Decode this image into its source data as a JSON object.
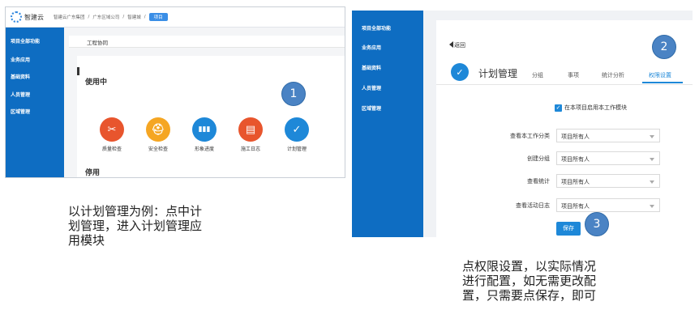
{
  "left": {
    "brand": "智建云",
    "breadcrumb": [
      "智建云广东集团",
      "/",
      "广东区域公司",
      "/",
      "智建城",
      "/"
    ],
    "breadcrumb_button": "项目",
    "sidebar": [
      "项目全部功能",
      "业务应用",
      "基础资料",
      "人员管理",
      "区域管理"
    ],
    "subtitle": "工程协同",
    "section_active": "使用中",
    "section_disabled": "停用",
    "modules": [
      {
        "label": "质量检查",
        "icon": "tools-icon",
        "color": "#e8552d"
      },
      {
        "label": "安全检查",
        "icon": "helmet-icon",
        "color": "#f5a623"
      },
      {
        "label": "形象进度",
        "icon": "progress-icon",
        "color": "#1e88d8"
      },
      {
        "label": "施工日志",
        "icon": "log-icon",
        "color": "#e8552d"
      },
      {
        "label": "计划管理",
        "icon": "check-icon",
        "color": "#1e88d8"
      }
    ]
  },
  "right": {
    "sidebar": [
      "项目全部功能",
      "业务应用",
      "基础资料",
      "人员管理",
      "区域管理"
    ],
    "back": "返回",
    "title": "计划管理",
    "tabs": [
      "分组",
      "事项",
      "统计分析",
      "权限设置"
    ],
    "active_tab": "权限设置",
    "checkbox_label": "在本项目启用本工作模块",
    "fields": [
      {
        "label": "查看本工作分类",
        "value": "项目所有人"
      },
      {
        "label": "创建分组",
        "value": "项目所有人"
      },
      {
        "label": "查看统计",
        "value": "项目所有人"
      },
      {
        "label": "查看活动日志",
        "value": "项目所有人"
      }
    ],
    "save": "保存"
  },
  "markers": [
    "1",
    "2",
    "3"
  ],
  "captions": {
    "left": [
      "以计划管理为例：点中计",
      "划管理，进入计划管理应",
      "用模块"
    ],
    "right": [
      "点权限设置，以实际情况",
      "进行配置，如无需更改配",
      "置，只需要点保存，即可"
    ]
  }
}
